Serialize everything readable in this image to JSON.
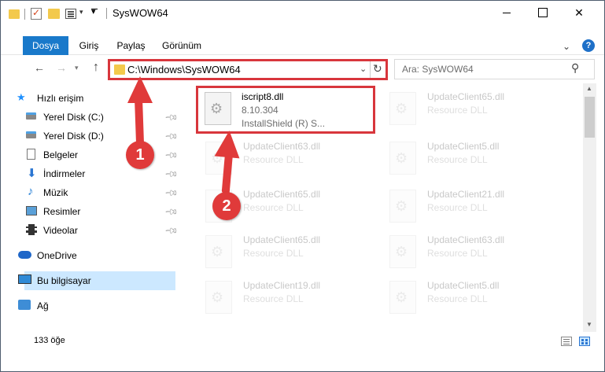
{
  "window": {
    "title": "SysWOW64"
  },
  "ribbon": {
    "tabs": [
      "Dosya",
      "Giriş",
      "Paylaş",
      "Görünüm"
    ],
    "help": "?"
  },
  "address": {
    "path": "C:\\Windows\\SysWOW64",
    "search_placeholder": "Ara: SysWOW64"
  },
  "sidebar": {
    "items": [
      {
        "label": "Hızlı erişim"
      },
      {
        "label": "Yerel Disk (C:)"
      },
      {
        "label": "Yerel Disk (D:)"
      },
      {
        "label": "Belgeler"
      },
      {
        "label": "İndirmeler"
      },
      {
        "label": "Müzik"
      },
      {
        "label": "Resimler"
      },
      {
        "label": "Videolar"
      },
      {
        "label": "OneDrive"
      },
      {
        "label": "Bu bilgisayar"
      },
      {
        "label": "Ağ"
      }
    ]
  },
  "files": [
    {
      "name": "iscript8.dll",
      "meta1": "8.10.304",
      "meta2": "InstallShield (R) S..."
    },
    {
      "name": "UpdateClient65.dll",
      "meta1": "Resource DLL",
      "meta2": ""
    },
    {
      "name": "UpdateClient63.dll",
      "meta1": "Resource DLL",
      "meta2": ""
    },
    {
      "name": "UpdateClient5.dll",
      "meta1": "Resource DLL",
      "meta2": ""
    },
    {
      "name": "UpdateClient65.dll",
      "meta1": "Resource DLL",
      "meta2": ""
    },
    {
      "name": "UpdateClient21.dll",
      "meta1": "Resource DLL",
      "meta2": ""
    },
    {
      "name": "UpdateClient65.dll",
      "meta1": "Resource DLL",
      "meta2": ""
    },
    {
      "name": "UpdateClient63.dll",
      "meta1": "Resource DLL",
      "meta2": ""
    },
    {
      "name": "UpdateClient19.dll",
      "meta1": "Resource DLL",
      "meta2": ""
    },
    {
      "name": "UpdateClient5.dll",
      "meta1": "Resource DLL",
      "meta2": ""
    }
  ],
  "status": {
    "count": "133 öğe"
  },
  "annotations": {
    "badge1": "1",
    "badge2": "2"
  },
  "colors": {
    "accent": "#1979ca",
    "highlight": "#d8363c",
    "selection": "#cce8ff"
  }
}
